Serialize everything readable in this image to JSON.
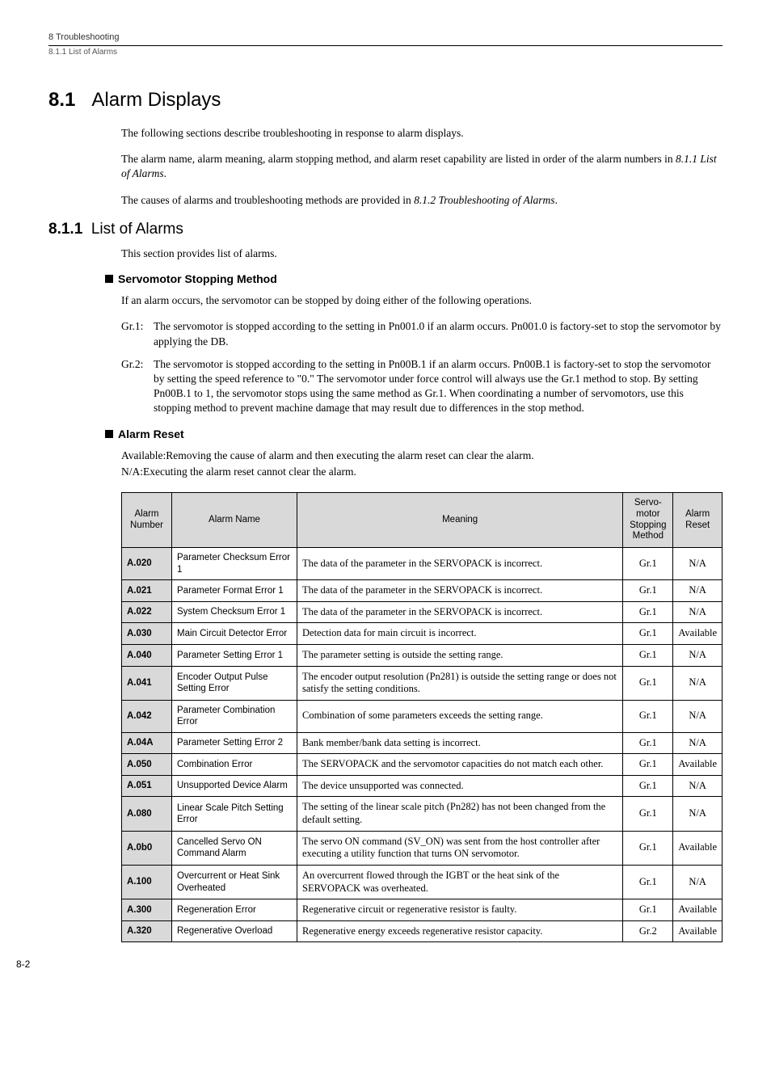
{
  "header": {
    "chapter": "8  Troubleshooting",
    "subsection_ref": "8.1.1  List of Alarms"
  },
  "section": {
    "number": "8.1",
    "title": "Alarm Displays",
    "intro": "The following sections describe troubleshooting in response to alarm displays.",
    "para2_a": "The alarm name, alarm meaning, alarm stopping method, and alarm reset capability are listed in order of the alarm numbers in ",
    "para2_ref": "8.1.1 List of Alarms",
    "para2_b": ".",
    "para3_a": "The causes of alarms and troubleshooting methods are provided in ",
    "para3_ref": "8.1.2 Troubleshooting of Alarms",
    "para3_b": "."
  },
  "sub": {
    "number": "8.1.1",
    "title": "List of Alarms",
    "intro": "This section provides list of alarms."
  },
  "stopping": {
    "title": "Servomotor Stopping Method",
    "intro": "If an alarm occurs, the servomotor can be stopped by doing either of the following operations.",
    "gr1_label": "Gr.1:",
    "gr1_text": "The servomotor is stopped according to the setting in Pn001.0 if an alarm occurs. Pn001.0 is factory-set to stop the servomotor by applying the DB.",
    "gr2_label": "Gr.2:",
    "gr2_text": "The servomotor is stopped according to the setting in Pn00B.1 if an alarm occurs. Pn00B.1 is factory-set to stop the servomotor by setting the speed reference to \"0.\" The servomotor under force control will always use the Gr.1 method to stop. By setting Pn00B.1 to 1, the servomotor stops using the same method as Gr.1. When coordinating a number of servomotors, use this stopping method to prevent machine damage that may result due to differences in the stop method."
  },
  "reset": {
    "title": "Alarm Reset",
    "line1": "Available:Removing the cause of alarm and then executing the alarm reset can clear the alarm.",
    "line2": "N/A:Executing the alarm reset cannot clear the alarm."
  },
  "table": {
    "headers": {
      "num": "Alarm Number",
      "name": "Alarm Name",
      "meaning": "Meaning",
      "method": "Servo-motor Stopping Method",
      "reset": "Alarm Reset"
    },
    "rows": [
      {
        "num": "A.020",
        "name": "Parameter Checksum Error 1",
        "meaning": "The data of the parameter in the SERVOPACK is incorrect.",
        "method": "Gr.1",
        "reset": "N/A"
      },
      {
        "num": "A.021",
        "name": "Parameter Format Error 1",
        "meaning": "The data of the parameter in the SERVOPACK is incorrect.",
        "method": "Gr.1",
        "reset": "N/A"
      },
      {
        "num": "A.022",
        "name": "System Checksum Error 1",
        "meaning": "The data of the parameter in the SERVOPACK is incorrect.",
        "method": "Gr.1",
        "reset": "N/A"
      },
      {
        "num": "A.030",
        "name": "Main Circuit Detector Error",
        "meaning": "Detection data for main circuit is incorrect.",
        "method": "Gr.1",
        "reset": "Available"
      },
      {
        "num": "A.040",
        "name": "Parameter Setting Error 1",
        "meaning": "The parameter setting is outside the setting range.",
        "method": "Gr.1",
        "reset": "N/A"
      },
      {
        "num": "A.041",
        "name": "Encoder Output Pulse Setting Error",
        "meaning": "The encoder output resolution (Pn281) is outside the setting range or does not satisfy the setting conditions.",
        "method": "Gr.1",
        "reset": "N/A"
      },
      {
        "num": "A.042",
        "name": "Parameter Combination Error",
        "meaning": "Combination of some parameters exceeds the setting range.",
        "method": "Gr.1",
        "reset": "N/A"
      },
      {
        "num": "A.04A",
        "name": "Parameter Setting Error 2",
        "meaning": "Bank member/bank data setting is incorrect.",
        "method": "Gr.1",
        "reset": "N/A"
      },
      {
        "num": "A.050",
        "name": "Combination Error",
        "meaning": "The SERVOPACK and the servomotor capacities do not match each other.",
        "method": "Gr.1",
        "reset": "Available"
      },
      {
        "num": "A.051",
        "name": "Unsupported Device Alarm",
        "meaning": "The device unsupported was connected.",
        "method": "Gr.1",
        "reset": "N/A"
      },
      {
        "num": "A.080",
        "name": "Linear Scale Pitch Setting Error",
        "meaning": "The setting of the linear scale pitch (Pn282) has not been changed from the default setting.",
        "method": "Gr.1",
        "reset": "N/A"
      },
      {
        "num": "A.0b0",
        "name": "Cancelled Servo ON Command Alarm",
        "meaning": "The servo ON command  (SV_ON) was sent from the host controller after executing a utility function that turns ON servomotor.",
        "method": "Gr.1",
        "reset": "Available"
      },
      {
        "num": "A.100",
        "name": "Overcurrent or Heat Sink Overheated",
        "meaning": "An overcurrent flowed through the IGBT or the heat sink of the SERVOPACK was overheated.",
        "method": "Gr.1",
        "reset": "N/A"
      },
      {
        "num": "A.300",
        "name": "Regeneration Error",
        "meaning": "Regenerative circuit or regenerative resistor is faulty.",
        "method": "Gr.1",
        "reset": "Available"
      },
      {
        "num": "A.320",
        "name": "Regenerative Overload",
        "meaning": "Regenerative energy exceeds regenerative resistor capacity.",
        "method": "Gr.2",
        "reset": "Available"
      }
    ]
  },
  "page_number": "8-2"
}
